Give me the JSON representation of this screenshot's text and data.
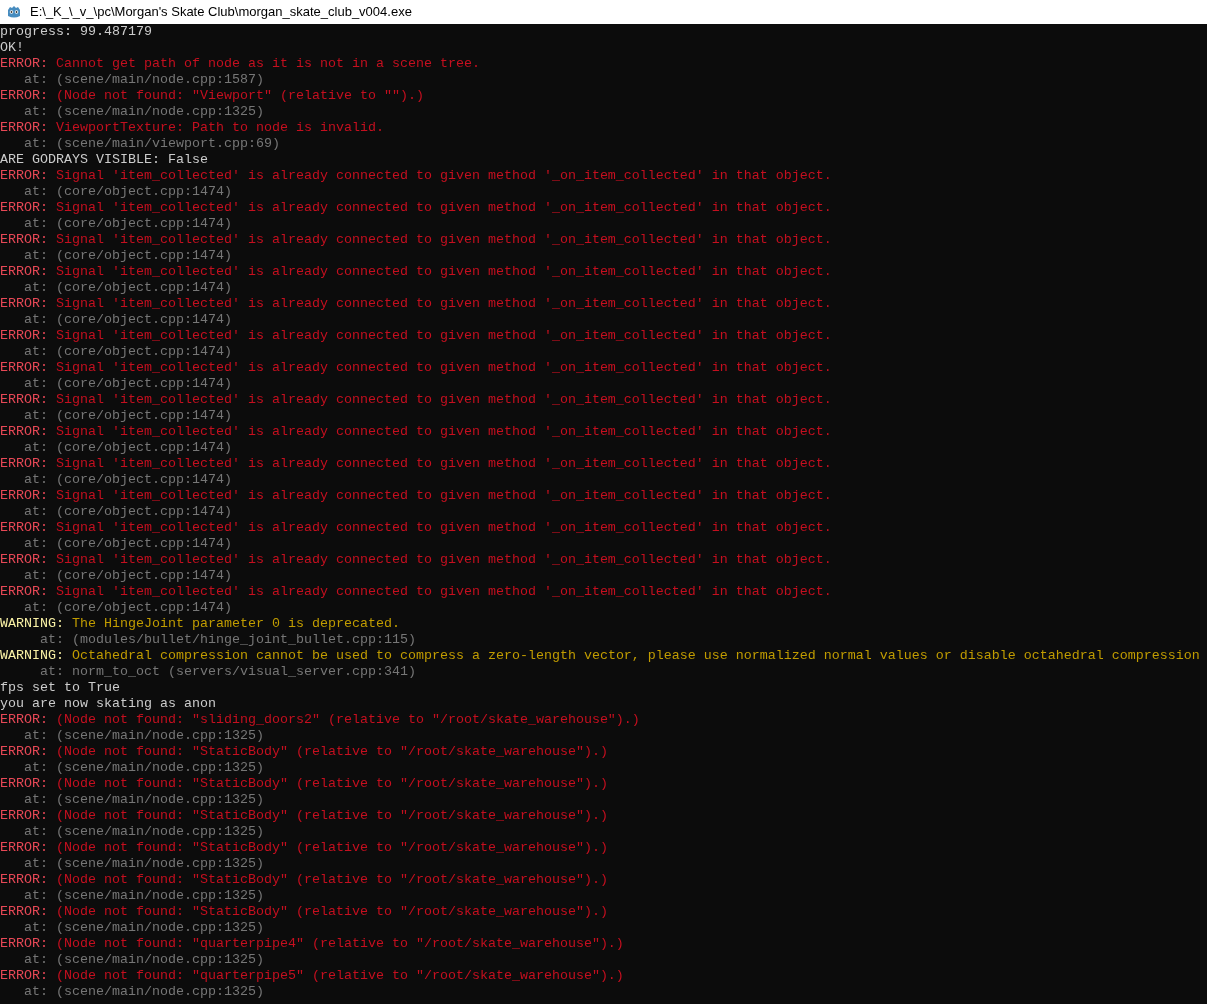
{
  "window": {
    "title": "E:\\_K_\\_v_\\pc\\Morgan's Skate Club\\morgan_skate_club_v004.exe"
  },
  "lines": [
    {
      "kind": "plain",
      "text": "progress: 99.487179"
    },
    {
      "kind": "plain",
      "text": "OK!"
    },
    {
      "kind": "error",
      "label": "ERROR:",
      "text": "Cannot get path of node as it is not in a scene tree."
    },
    {
      "kind": "trace",
      "text": "at: (scene/main/node.cpp:1587)"
    },
    {
      "kind": "error",
      "label": "ERROR:",
      "text": "(Node not found: \"Viewport\" (relative to \"\").)"
    },
    {
      "kind": "trace",
      "text": "at: (scene/main/node.cpp:1325)"
    },
    {
      "kind": "error",
      "label": "ERROR:",
      "text": "ViewportTexture: Path to node is invalid."
    },
    {
      "kind": "trace",
      "text": "at: (scene/main/viewport.cpp:69)"
    },
    {
      "kind": "plain",
      "text": "ARE GODRAYS VISIBLE: False"
    },
    {
      "kind": "error",
      "label": "ERROR:",
      "text": "Signal 'item_collected' is already connected to given method '_on_item_collected' in that object."
    },
    {
      "kind": "trace",
      "text": "at: (core/object.cpp:1474)"
    },
    {
      "kind": "error",
      "label": "ERROR:",
      "text": "Signal 'item_collected' is already connected to given method '_on_item_collected' in that object."
    },
    {
      "kind": "trace",
      "text": "at: (core/object.cpp:1474)"
    },
    {
      "kind": "error",
      "label": "ERROR:",
      "text": "Signal 'item_collected' is already connected to given method '_on_item_collected' in that object."
    },
    {
      "kind": "trace",
      "text": "at: (core/object.cpp:1474)"
    },
    {
      "kind": "error",
      "label": "ERROR:",
      "text": "Signal 'item_collected' is already connected to given method '_on_item_collected' in that object."
    },
    {
      "kind": "trace",
      "text": "at: (core/object.cpp:1474)"
    },
    {
      "kind": "error",
      "label": "ERROR:",
      "text": "Signal 'item_collected' is already connected to given method '_on_item_collected' in that object."
    },
    {
      "kind": "trace",
      "text": "at: (core/object.cpp:1474)"
    },
    {
      "kind": "error",
      "label": "ERROR:",
      "text": "Signal 'item_collected' is already connected to given method '_on_item_collected' in that object."
    },
    {
      "kind": "trace",
      "text": "at: (core/object.cpp:1474)"
    },
    {
      "kind": "error",
      "label": "ERROR:",
      "text": "Signal 'item_collected' is already connected to given method '_on_item_collected' in that object."
    },
    {
      "kind": "trace",
      "text": "at: (core/object.cpp:1474)"
    },
    {
      "kind": "error",
      "label": "ERROR:",
      "text": "Signal 'item_collected' is already connected to given method '_on_item_collected' in that object."
    },
    {
      "kind": "trace",
      "text": "at: (core/object.cpp:1474)"
    },
    {
      "kind": "error",
      "label": "ERROR:",
      "text": "Signal 'item_collected' is already connected to given method '_on_item_collected' in that object."
    },
    {
      "kind": "trace",
      "text": "at: (core/object.cpp:1474)"
    },
    {
      "kind": "error",
      "label": "ERROR:",
      "text": "Signal 'item_collected' is already connected to given method '_on_item_collected' in that object."
    },
    {
      "kind": "trace",
      "text": "at: (core/object.cpp:1474)"
    },
    {
      "kind": "error",
      "label": "ERROR:",
      "text": "Signal 'item_collected' is already connected to given method '_on_item_collected' in that object."
    },
    {
      "kind": "trace",
      "text": "at: (core/object.cpp:1474)"
    },
    {
      "kind": "error",
      "label": "ERROR:",
      "text": "Signal 'item_collected' is already connected to given method '_on_item_collected' in that object."
    },
    {
      "kind": "trace",
      "text": "at: (core/object.cpp:1474)"
    },
    {
      "kind": "error",
      "label": "ERROR:",
      "text": "Signal 'item_collected' is already connected to given method '_on_item_collected' in that object."
    },
    {
      "kind": "trace",
      "text": "at: (core/object.cpp:1474)"
    },
    {
      "kind": "error",
      "label": "ERROR:",
      "text": "Signal 'item_collected' is already connected to given method '_on_item_collected' in that object."
    },
    {
      "kind": "trace",
      "text": "at: (core/object.cpp:1474)"
    },
    {
      "kind": "warning",
      "label": "WARNING:",
      "text": "The HingeJoint parameter 0 is deprecated."
    },
    {
      "kind": "warning_trace",
      "text": "at: (modules/bullet/hinge_joint_bullet.cpp:115)"
    },
    {
      "kind": "warning",
      "label": "WARNING:",
      "text": "Octahedral compression cannot be used to compress a zero-length vector, please use normalized normal values or disable octahedral compression"
    },
    {
      "kind": "warning_trace",
      "text": "at: norm_to_oct (servers/visual_server.cpp:341)"
    },
    {
      "kind": "plain",
      "text": "fps set to True"
    },
    {
      "kind": "plain",
      "text": "you are now skating as anon"
    },
    {
      "kind": "error",
      "label": "ERROR:",
      "text": "(Node not found: \"sliding_doors2\" (relative to \"/root/skate_warehouse\").)"
    },
    {
      "kind": "trace",
      "text": "at: (scene/main/node.cpp:1325)"
    },
    {
      "kind": "error",
      "label": "ERROR:",
      "text": "(Node not found: \"StaticBody\" (relative to \"/root/skate_warehouse\").)"
    },
    {
      "kind": "trace",
      "text": "at: (scene/main/node.cpp:1325)"
    },
    {
      "kind": "error",
      "label": "ERROR:",
      "text": "(Node not found: \"StaticBody\" (relative to \"/root/skate_warehouse\").)"
    },
    {
      "kind": "trace",
      "text": "at: (scene/main/node.cpp:1325)"
    },
    {
      "kind": "error",
      "label": "ERROR:",
      "text": "(Node not found: \"StaticBody\" (relative to \"/root/skate_warehouse\").)"
    },
    {
      "kind": "trace",
      "text": "at: (scene/main/node.cpp:1325)"
    },
    {
      "kind": "error",
      "label": "ERROR:",
      "text": "(Node not found: \"StaticBody\" (relative to \"/root/skate_warehouse\").)"
    },
    {
      "kind": "trace",
      "text": "at: (scene/main/node.cpp:1325)"
    },
    {
      "kind": "error",
      "label": "ERROR:",
      "text": "(Node not found: \"StaticBody\" (relative to \"/root/skate_warehouse\").)"
    },
    {
      "kind": "trace",
      "text": "at: (scene/main/node.cpp:1325)"
    },
    {
      "kind": "error",
      "label": "ERROR:",
      "text": "(Node not found: \"StaticBody\" (relative to \"/root/skate_warehouse\").)"
    },
    {
      "kind": "trace",
      "text": "at: (scene/main/node.cpp:1325)"
    },
    {
      "kind": "error",
      "label": "ERROR:",
      "text": "(Node not found: \"quarterpipe4\" (relative to \"/root/skate_warehouse\").)"
    },
    {
      "kind": "trace",
      "text": "at: (scene/main/node.cpp:1325)"
    },
    {
      "kind": "error",
      "label": "ERROR:",
      "text": "(Node not found: \"quarterpipe5\" (relative to \"/root/skate_warehouse\").)"
    },
    {
      "kind": "trace",
      "text": "at: (scene/main/node.cpp:1325)"
    }
  ]
}
